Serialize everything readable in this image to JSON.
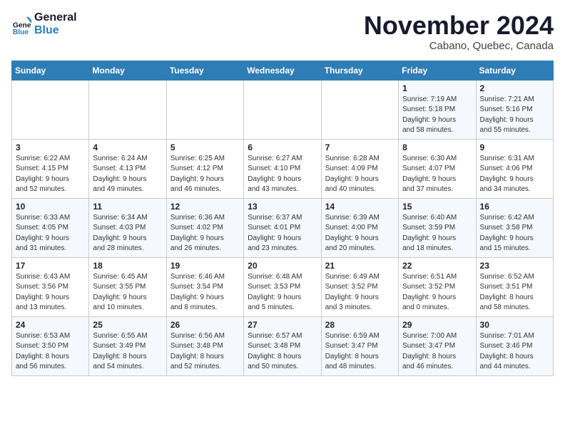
{
  "logo": {
    "line1": "General",
    "line2": "Blue"
  },
  "title": "November 2024",
  "subtitle": "Cabano, Quebec, Canada",
  "days_of_week": [
    "Sunday",
    "Monday",
    "Tuesday",
    "Wednesday",
    "Thursday",
    "Friday",
    "Saturday"
  ],
  "weeks": [
    [
      {
        "day": "",
        "info": ""
      },
      {
        "day": "",
        "info": ""
      },
      {
        "day": "",
        "info": ""
      },
      {
        "day": "",
        "info": ""
      },
      {
        "day": "",
        "info": ""
      },
      {
        "day": "1",
        "info": "Sunrise: 7:19 AM\nSunset: 5:18 PM\nDaylight: 9 hours\nand 58 minutes."
      },
      {
        "day": "2",
        "info": "Sunrise: 7:21 AM\nSunset: 5:16 PM\nDaylight: 9 hours\nand 55 minutes."
      }
    ],
    [
      {
        "day": "3",
        "info": "Sunrise: 6:22 AM\nSunset: 4:15 PM\nDaylight: 9 hours\nand 52 minutes."
      },
      {
        "day": "4",
        "info": "Sunrise: 6:24 AM\nSunset: 4:13 PM\nDaylight: 9 hours\nand 49 minutes."
      },
      {
        "day": "5",
        "info": "Sunrise: 6:25 AM\nSunset: 4:12 PM\nDaylight: 9 hours\nand 46 minutes."
      },
      {
        "day": "6",
        "info": "Sunrise: 6:27 AM\nSunset: 4:10 PM\nDaylight: 9 hours\nand 43 minutes."
      },
      {
        "day": "7",
        "info": "Sunrise: 6:28 AM\nSunset: 4:09 PM\nDaylight: 9 hours\nand 40 minutes."
      },
      {
        "day": "8",
        "info": "Sunrise: 6:30 AM\nSunset: 4:07 PM\nDaylight: 9 hours\nand 37 minutes."
      },
      {
        "day": "9",
        "info": "Sunrise: 6:31 AM\nSunset: 4:06 PM\nDaylight: 9 hours\nand 34 minutes."
      }
    ],
    [
      {
        "day": "10",
        "info": "Sunrise: 6:33 AM\nSunset: 4:05 PM\nDaylight: 9 hours\nand 31 minutes."
      },
      {
        "day": "11",
        "info": "Sunrise: 6:34 AM\nSunset: 4:03 PM\nDaylight: 9 hours\nand 28 minutes."
      },
      {
        "day": "12",
        "info": "Sunrise: 6:36 AM\nSunset: 4:02 PM\nDaylight: 9 hours\nand 26 minutes."
      },
      {
        "day": "13",
        "info": "Sunrise: 6:37 AM\nSunset: 4:01 PM\nDaylight: 9 hours\nand 23 minutes."
      },
      {
        "day": "14",
        "info": "Sunrise: 6:39 AM\nSunset: 4:00 PM\nDaylight: 9 hours\nand 20 minutes."
      },
      {
        "day": "15",
        "info": "Sunrise: 6:40 AM\nSunset: 3:59 PM\nDaylight: 9 hours\nand 18 minutes."
      },
      {
        "day": "16",
        "info": "Sunrise: 6:42 AM\nSunset: 3:58 PM\nDaylight: 9 hours\nand 15 minutes."
      }
    ],
    [
      {
        "day": "17",
        "info": "Sunrise: 6:43 AM\nSunset: 3:56 PM\nDaylight: 9 hours\nand 13 minutes."
      },
      {
        "day": "18",
        "info": "Sunrise: 6:45 AM\nSunset: 3:55 PM\nDaylight: 9 hours\nand 10 minutes."
      },
      {
        "day": "19",
        "info": "Sunrise: 6:46 AM\nSunset: 3:54 PM\nDaylight: 9 hours\nand 8 minutes."
      },
      {
        "day": "20",
        "info": "Sunrise: 6:48 AM\nSunset: 3:53 PM\nDaylight: 9 hours\nand 5 minutes."
      },
      {
        "day": "21",
        "info": "Sunrise: 6:49 AM\nSunset: 3:52 PM\nDaylight: 9 hours\nand 3 minutes."
      },
      {
        "day": "22",
        "info": "Sunrise: 6:51 AM\nSunset: 3:52 PM\nDaylight: 9 hours\nand 0 minutes."
      },
      {
        "day": "23",
        "info": "Sunrise: 6:52 AM\nSunset: 3:51 PM\nDaylight: 8 hours\nand 58 minutes."
      }
    ],
    [
      {
        "day": "24",
        "info": "Sunrise: 6:53 AM\nSunset: 3:50 PM\nDaylight: 8 hours\nand 56 minutes."
      },
      {
        "day": "25",
        "info": "Sunrise: 6:55 AM\nSunset: 3:49 PM\nDaylight: 8 hours\nand 54 minutes."
      },
      {
        "day": "26",
        "info": "Sunrise: 6:56 AM\nSunset: 3:48 PM\nDaylight: 8 hours\nand 52 minutes."
      },
      {
        "day": "27",
        "info": "Sunrise: 6:57 AM\nSunset: 3:48 PM\nDaylight: 8 hours\nand 50 minutes."
      },
      {
        "day": "28",
        "info": "Sunrise: 6:59 AM\nSunset: 3:47 PM\nDaylight: 8 hours\nand 48 minutes."
      },
      {
        "day": "29",
        "info": "Sunrise: 7:00 AM\nSunset: 3:47 PM\nDaylight: 8 hours\nand 46 minutes."
      },
      {
        "day": "30",
        "info": "Sunrise: 7:01 AM\nSunset: 3:46 PM\nDaylight: 8 hours\nand 44 minutes."
      }
    ]
  ]
}
